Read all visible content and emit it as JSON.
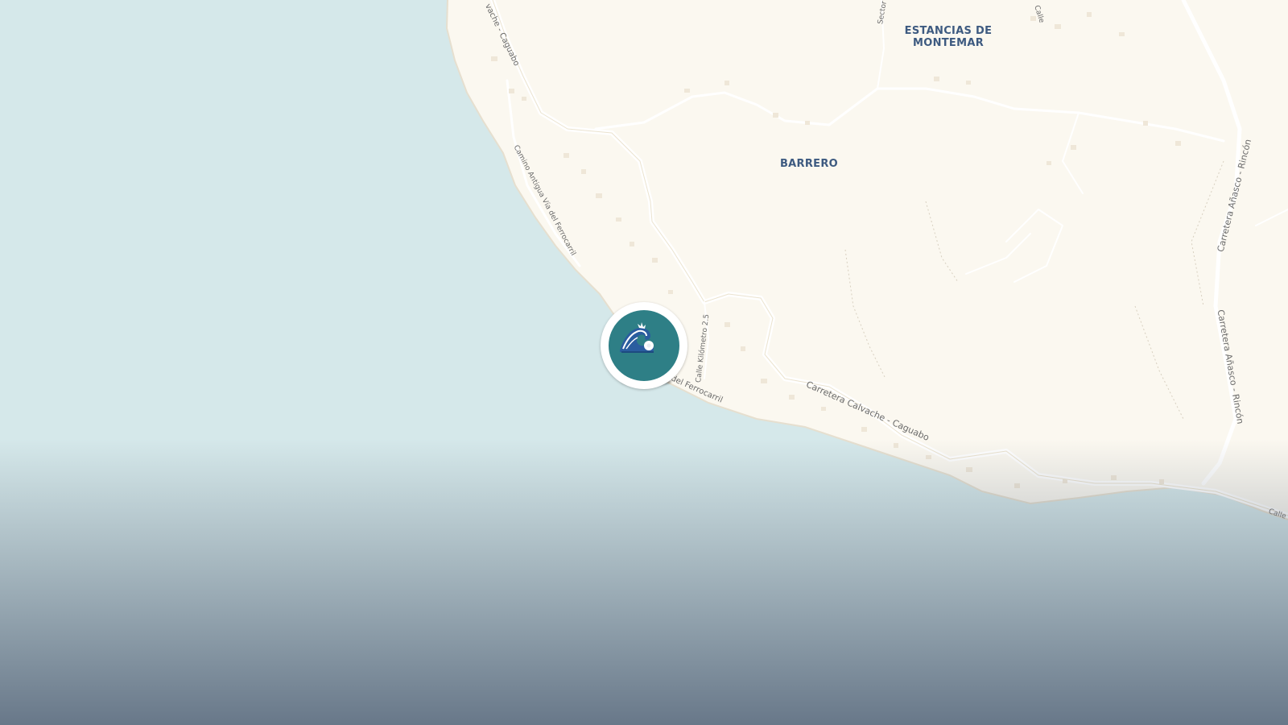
{
  "map": {
    "areas": {
      "estancias": "ESTANCIAS DE\nMONTEMAR",
      "barrero": "BARRERO"
    },
    "roads": {
      "calvache_caguabo_top": "vache - Caguabo",
      "camino_antigua": "Camino Antigua Vía del Ferrocarril",
      "del_ferrocarril": "del Ferrocarril",
      "calle_kilometro": "Calle Kilómetro 2.5",
      "carretera_calvache": "Carretera Calvache - Caguabo",
      "anasco_rincon_upper": "Carretera Añasco - Rincón",
      "anasco_rincon_lower": "Carretera Añasco - Rincón",
      "sector": "Sector",
      "calle_edge": "Calle",
      "calle_top": "Calle"
    },
    "colors": {
      "land": "#fbf8f0",
      "water": "#d5e8ea",
      "road": "#ffffff",
      "marker": "#2e7f86"
    },
    "marker": {
      "icon": "water-wave-icon"
    }
  }
}
